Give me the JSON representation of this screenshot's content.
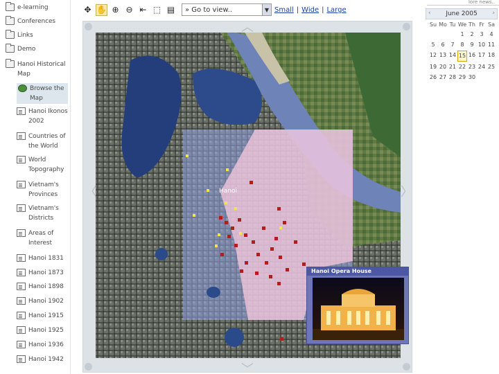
{
  "nav": {
    "items": [
      {
        "label": "e-learning",
        "type": "folder"
      },
      {
        "label": "Conferences",
        "type": "folder"
      },
      {
        "label": "Links",
        "type": "folder"
      },
      {
        "label": "Demo",
        "type": "folder"
      },
      {
        "label": "Hanoi Historical Map",
        "type": "folder"
      },
      {
        "label": "Browse the Map",
        "type": "globe"
      },
      {
        "label": "Hanoi Ikonos 2002",
        "type": "doc"
      },
      {
        "label": "Countries of the World",
        "type": "doc"
      },
      {
        "label": "World Topography",
        "type": "doc"
      },
      {
        "label": "Vietnam's Provinces",
        "type": "doc"
      },
      {
        "label": "Vietnam's Districts",
        "type": "doc"
      },
      {
        "label": "Areas of Interest",
        "type": "doc"
      },
      {
        "label": "Hanoi 1831",
        "type": "doc"
      },
      {
        "label": "Hanoi 1873",
        "type": "doc"
      },
      {
        "label": "Hanoi 1898",
        "type": "doc"
      },
      {
        "label": "Hanoi 1902",
        "type": "doc"
      },
      {
        "label": "Hanoi 1915",
        "type": "doc"
      },
      {
        "label": "Hanoi 1925",
        "type": "doc"
      },
      {
        "label": "Hanoi 1936",
        "type": "doc"
      },
      {
        "label": "Hanoi 1942",
        "type": "doc"
      }
    ]
  },
  "toolbar": {
    "tools": [
      "pan-hand",
      "zoom-in",
      "zoom-out",
      "full-extent",
      "select",
      "layers"
    ],
    "goto_placeholder": "» Go to view..",
    "size_small": "Small",
    "size_wide": "Wide",
    "size_large": "Large",
    "separator": "|"
  },
  "calendar": {
    "month_label": "June 2005",
    "more_news": "lore news..",
    "weekdays": [
      "Su",
      "Mo",
      "Tu",
      "We",
      "Th",
      "Fr",
      "Sa"
    ],
    "days": [
      "",
      "",
      "",
      "1",
      "2",
      "3",
      "4",
      "5",
      "6",
      "7",
      "8",
      "9",
      "10",
      "11",
      "12",
      "13",
      "14",
      "15",
      "16",
      "17",
      "18",
      "19",
      "20",
      "21",
      "22",
      "23",
      "24",
      "25",
      "26",
      "27",
      "28",
      "29",
      "30",
      ""
    ],
    "today": "15"
  },
  "map": {
    "place_label": "Hanoi",
    "popup_title": "Hanoi Opera House"
  },
  "colors": {
    "link": "#1a3fa3",
    "water": "#2c4f8c",
    "overlay_pink": "#f3c6dc",
    "overlay_blue": "#8fa0e0",
    "marker_red": "#b31d1d",
    "marker_yellow": "#f2e64a",
    "popup_bg": "#6d76b8"
  }
}
